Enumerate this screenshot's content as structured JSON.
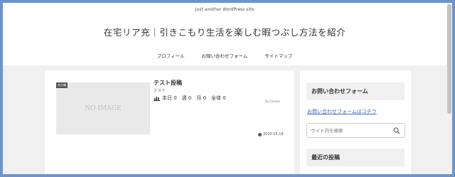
{
  "header": {
    "tagline": "Just another WordPress site",
    "site_title": "在宅リア充｜引きこもり生活を楽しむ暇つぶし方法を紹介",
    "nav": [
      "プロフィール",
      "お問い合わせフォーム",
      "サイトマップ"
    ]
  },
  "post": {
    "category": "未分類",
    "no_image": "NO IMAGE",
    "title": "テスト投稿",
    "snippet": "テスト",
    "views_icon": "bar-chart-icon",
    "views": "本日 0　週 0　月 0　全体 0",
    "author": "by Cocoon",
    "date_icon": "clock-icon",
    "date": "2020.05.18"
  },
  "sidebar": {
    "contact_heading": "お問い合わせフォーム",
    "contact_link": "お問い合わせフォームはコチラ",
    "search_placeholder": "サイト内を検索",
    "recent_heading": "最近の投稿"
  },
  "colors": {
    "border": "#6f93c9",
    "link": "#3a6ab9",
    "content_bg": "#f0f0f0"
  }
}
